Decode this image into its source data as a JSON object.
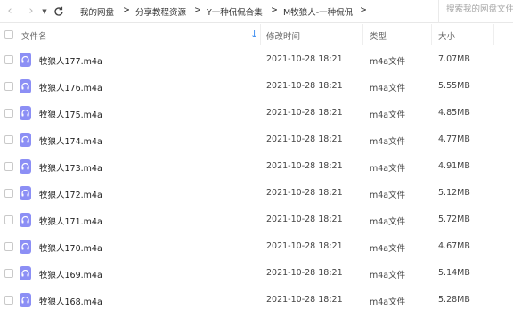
{
  "toolbar": {
    "back_icon": "chevron-left-icon",
    "forward_icon": "chevron-right-icon",
    "history_icon": "caret-down-icon",
    "refresh_icon": "refresh-icon",
    "breadcrumbs": [
      "我的网盘",
      "分享教程资源",
      "Y一种侃侃合集",
      "M牧狼人-一种侃侃"
    ],
    "separator": ">",
    "search_placeholder": "搜索我的网盘文件"
  },
  "header": {
    "name": "文件名",
    "modified": "修改时间",
    "type": "类型",
    "size": "大小",
    "sort_icon": "sort-down-arrow-icon"
  },
  "files": [
    {
      "name": "牧狼人177.m4a",
      "modified": "2021-10-28 18:21",
      "type": "m4a文件",
      "size": "7.07MB"
    },
    {
      "name": "牧狼人176.m4a",
      "modified": "2021-10-28 18:21",
      "type": "m4a文件",
      "size": "5.55MB"
    },
    {
      "name": "牧狼人175.m4a",
      "modified": "2021-10-28 18:21",
      "type": "m4a文件",
      "size": "4.85MB"
    },
    {
      "name": "牧狼人174.m4a",
      "modified": "2021-10-28 18:21",
      "type": "m4a文件",
      "size": "4.77MB"
    },
    {
      "name": "牧狼人173.m4a",
      "modified": "2021-10-28 18:21",
      "type": "m4a文件",
      "size": "4.91MB"
    },
    {
      "name": "牧狼人172.m4a",
      "modified": "2021-10-28 18:21",
      "type": "m4a文件",
      "size": "5.12MB"
    },
    {
      "name": "牧狼人171.m4a",
      "modified": "2021-10-28 18:21",
      "type": "m4a文件",
      "size": "5.72MB"
    },
    {
      "name": "牧狼人170.m4a",
      "modified": "2021-10-28 18:21",
      "type": "m4a文件",
      "size": "4.67MB"
    },
    {
      "name": "牧狼人169.m4a",
      "modified": "2021-10-28 18:21",
      "type": "m4a文件",
      "size": "5.14MB"
    },
    {
      "name": "牧狼人168.m4a",
      "modified": "2021-10-28 18:21",
      "type": "m4a文件",
      "size": "5.28MB"
    }
  ],
  "colors": {
    "audio_icon_bg": "#8c8ff5",
    "sort_arrow": "#3b8cf0"
  }
}
